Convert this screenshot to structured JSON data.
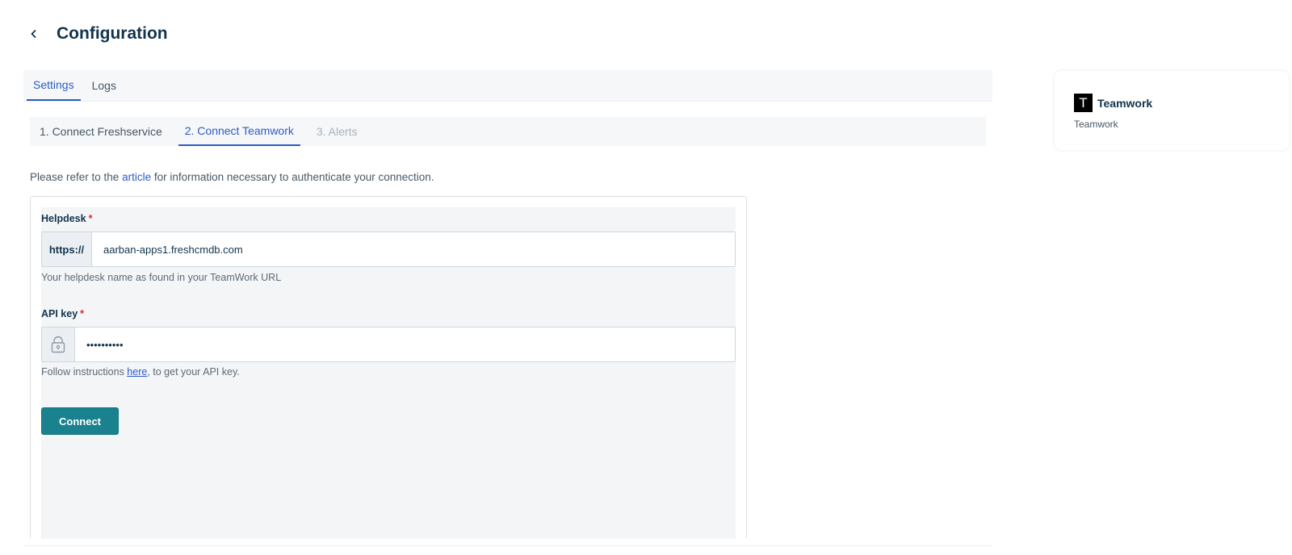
{
  "header": {
    "title": "Configuration",
    "back_icon": "chevron-left-icon"
  },
  "tabs": [
    {
      "label": "Settings",
      "active": true
    },
    {
      "label": "Logs",
      "active": false
    }
  ],
  "steps": [
    {
      "label": "1. Connect Freshservice",
      "state": "default"
    },
    {
      "label": "2. Connect Teamwork",
      "state": "active"
    },
    {
      "label": "3. Alerts",
      "state": "disabled"
    }
  ],
  "intro": {
    "before": "Please refer to the ",
    "link": "article",
    "after": " for information necessary to authenticate your connection."
  },
  "form": {
    "helpdesk": {
      "label": "Helpdesk",
      "required_mark": "*",
      "prefix": "https://",
      "value": "aarban-apps1.freshcmdb.com",
      "hint": "Your helpdesk name as found in your TeamWork URL"
    },
    "api_key": {
      "label": "API key",
      "required_mark": "*",
      "prefix_icon": "lock-icon",
      "value": "••••••••••",
      "hint_before": "Follow instructions ",
      "hint_link": "here",
      "hint_after": ", to get your API key."
    },
    "connect_label": "Connect"
  },
  "app_card": {
    "logo_letter": "T",
    "name": "Teamwork",
    "subtitle": "Teamwork"
  },
  "colors": {
    "accent": "#2c5cc5",
    "primary_button": "#1a818e",
    "text_dark": "#12344d",
    "required": "#d72d30"
  }
}
